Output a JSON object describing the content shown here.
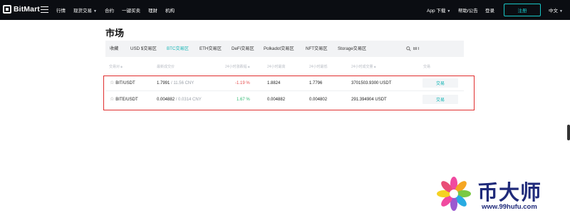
{
  "header": {
    "logo": "BitMart",
    "nav": [
      {
        "label": "行情",
        "caret": false
      },
      {
        "label": "现货交易",
        "caret": true
      },
      {
        "label": "合约",
        "caret": false
      },
      {
        "label": "一键买卖",
        "caret": false
      },
      {
        "label": "理财",
        "caret": false
      },
      {
        "label": "机构",
        "caret": false
      }
    ],
    "app_download": "App 下载",
    "help": "帮助/公告",
    "login": "登录",
    "register": "注册",
    "language": "中文"
  },
  "page_title": "市场",
  "tabs": [
    {
      "label": "收藏",
      "active": false
    },
    {
      "label": "USD $交易区",
      "active": false
    },
    {
      "label": "BTC交易区",
      "active": true
    },
    {
      "label": "ETH交易区",
      "active": false
    },
    {
      "label": "DeFi交易区",
      "active": false
    },
    {
      "label": "Polkadot交易区",
      "active": false
    },
    {
      "label": "NFT交易区",
      "active": false
    },
    {
      "label": "Storage交易区",
      "active": false
    }
  ],
  "search": {
    "value": "BIT"
  },
  "table": {
    "columns": [
      "交易对",
      "最新成交价",
      "24小时涨跌幅",
      "24小时最高",
      "24小时最低",
      "24小时成交量",
      "交易"
    ],
    "rows": [
      {
        "pair": "BIT/USDT",
        "price": "1.7991",
        "price_cny": "/ 11.56 CNY",
        "change": "-1.19 %",
        "change_dir": "neg",
        "high": "1.8824",
        "low": "1.7796",
        "volume": "3701503.9300 USDT",
        "action": "交易"
      },
      {
        "pair": "BITE/USDT",
        "price": "0.004882",
        "price_cny": "/ 0.0314 CNY",
        "change": "1.67 %",
        "change_dir": "pos",
        "high": "0.004882",
        "low": "0.004802",
        "volume": "291.394904 USDT",
        "action": "交易"
      }
    ]
  },
  "watermark": {
    "text": "币大师",
    "url": "www.99hufu.com"
  },
  "colors": {
    "accent": "#16b5b5",
    "negative": "#e64b4b",
    "positive": "#2eb872",
    "highlight": "#e02f2f",
    "topbar": "#0b0d12"
  }
}
